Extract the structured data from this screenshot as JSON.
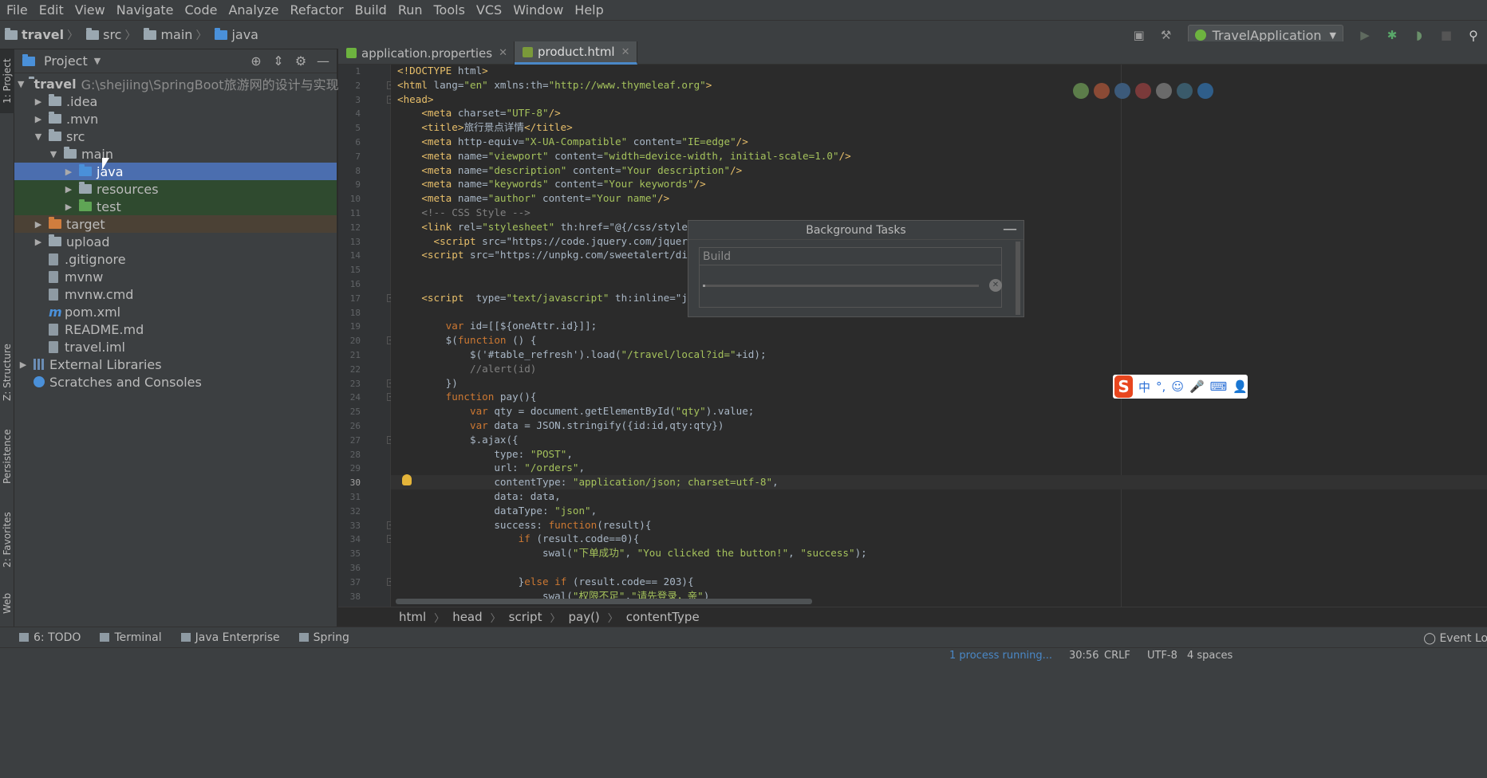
{
  "menu": [
    "File",
    "Edit",
    "View",
    "Navigate",
    "Code",
    "Analyze",
    "Refactor",
    "Build",
    "Run",
    "Tools",
    "VCS",
    "Window",
    "Help"
  ],
  "nav": {
    "crumbs": [
      "travel",
      "src",
      "main",
      "java"
    ],
    "run_config": "TravelApplication"
  },
  "left_strip": {
    "project": "1: Project",
    "structure": "Z: Structure",
    "persistence": "Persistence",
    "favorites": "2: Favorites",
    "web": "Web"
  },
  "project": {
    "title": "Project",
    "root_name": "travel",
    "root_path": "G:\\shejiing\\SpringBoot旅游网的设计与实现\\travel",
    "items": [
      {
        "label": "travel",
        "depth": 0,
        "arrow": "▼",
        "icon": "folder"
      },
      {
        "label": ".idea",
        "depth": 1,
        "arrow": "▶",
        "icon": "folder"
      },
      {
        "label": ".mvn",
        "depth": 1,
        "arrow": "▶",
        "icon": "folder"
      },
      {
        "label": "src",
        "depth": 1,
        "arrow": "▼",
        "icon": "folder"
      },
      {
        "label": "main",
        "depth": 2,
        "arrow": "▼",
        "icon": "folder"
      },
      {
        "label": "java",
        "depth": 3,
        "arrow": "▶",
        "icon": "folder-blue"
      },
      {
        "label": "resources",
        "depth": 3,
        "arrow": "▶",
        "icon": "folder"
      },
      {
        "label": "test",
        "depth": 3,
        "arrow": "▶",
        "icon": "folder-green"
      },
      {
        "label": "target",
        "depth": 1,
        "arrow": "▶",
        "icon": "folder-orange"
      },
      {
        "label": "upload",
        "depth": 1,
        "arrow": "▶",
        "icon": "folder"
      },
      {
        "label": ".gitignore",
        "depth": 1,
        "arrow": "",
        "icon": "file"
      },
      {
        "label": "mvnw",
        "depth": 1,
        "arrow": "",
        "icon": "file"
      },
      {
        "label": "mvnw.cmd",
        "depth": 1,
        "arrow": "",
        "icon": "file"
      },
      {
        "label": "pom.xml",
        "depth": 1,
        "arrow": "",
        "icon": "maven"
      },
      {
        "label": "README.md",
        "depth": 1,
        "arrow": "",
        "icon": "file"
      },
      {
        "label": "travel.iml",
        "depth": 1,
        "arrow": "",
        "icon": "file"
      },
      {
        "label": "External Libraries",
        "depth": 0,
        "arrow": "▶",
        "icon": "library"
      },
      {
        "label": "Scratches and Consoles",
        "depth": 0,
        "arrow": "",
        "icon": "scratch"
      }
    ]
  },
  "tabs": [
    {
      "label": "application.properties",
      "active": false
    },
    {
      "label": "product.html",
      "active": true
    }
  ],
  "code_lines": [
    "<!DOCTYPE html>",
    "<html lang=\"en\" xmlns:th=\"http://www.thymeleaf.org\">",
    "<head>",
    "    <meta charset=\"UTF-8\"/>",
    "    <title>旅行景点详情</title>",
    "    <meta http-equiv=\"X-UA-Compatible\" content=\"IE=edge\"/>",
    "    <meta name=\"viewport\" content=\"width=device-width, initial-scale=1.0\"/>",
    "    <meta name=\"description\" content=\"Your description\"/>",
    "    <meta name=\"keywords\" content=\"Your keywords\"/>",
    "    <meta name=\"author\" content=\"Your name\"/>",
    "    <!-- CSS Style -->",
    "    <link rel=\"stylesheet\" th:href=\"@{/css/style",
    "      <script src=\"https://code.jquery.com/jquery",
    "    <script src=\"https://unpkg.com/sweetalert/di",
    "",
    "",
    "    <script  type=\"text/javascript\" th:inline=\"ja",
    "",
    "        var id=[[${oneAttr.id}]];",
    "        $(function () {",
    "            $('#table_refresh').load(\"/travel/local?id=\"+id);",
    "            //alert(id)",
    "        })",
    "        function pay(){",
    "            var qty = document.getElementById(\"qty\").value;",
    "            var data = JSON.stringify({id:id,qty:qty})",
    "            $.ajax({",
    "                type: \"POST\",",
    "                url: \"/orders\",",
    "                contentType: \"application/json; charset=utf-8\",",
    "                data: data,",
    "                dataType: \"json\",",
    "                success: function(result){",
    "                    if (result.code==0){",
    "                        swal(\"下单成功\", \"You clicked the button!\", \"success\");",
    "",
    "                    }else if (result.code== 203){",
    "                        swal(\"权限不足\",\"请先登录，亲\")"
  ],
  "current_line": 30,
  "background_tasks": {
    "title": "Background Tasks",
    "task": "Build",
    "progress": 0.01
  },
  "ime": {
    "logo": "S",
    "lang": "中",
    "punct": "°,",
    "emoji": "☺",
    "mic": "🎤",
    "keyboard": "⌨",
    "user": "👤"
  },
  "breadcrumbs": [
    "html",
    "head",
    "script",
    "pay()",
    "contentType"
  ],
  "tool_windows": [
    {
      "label": "6: TODO"
    },
    {
      "label": "Terminal"
    },
    {
      "label": "Java Enterprise"
    },
    {
      "label": "Spring"
    }
  ],
  "event_log": "Event Log",
  "status": {
    "process": "1 process running...",
    "position": "30:56",
    "line_sep": "CRLF",
    "encoding": "UTF-8",
    "indent": "4 spaces"
  }
}
